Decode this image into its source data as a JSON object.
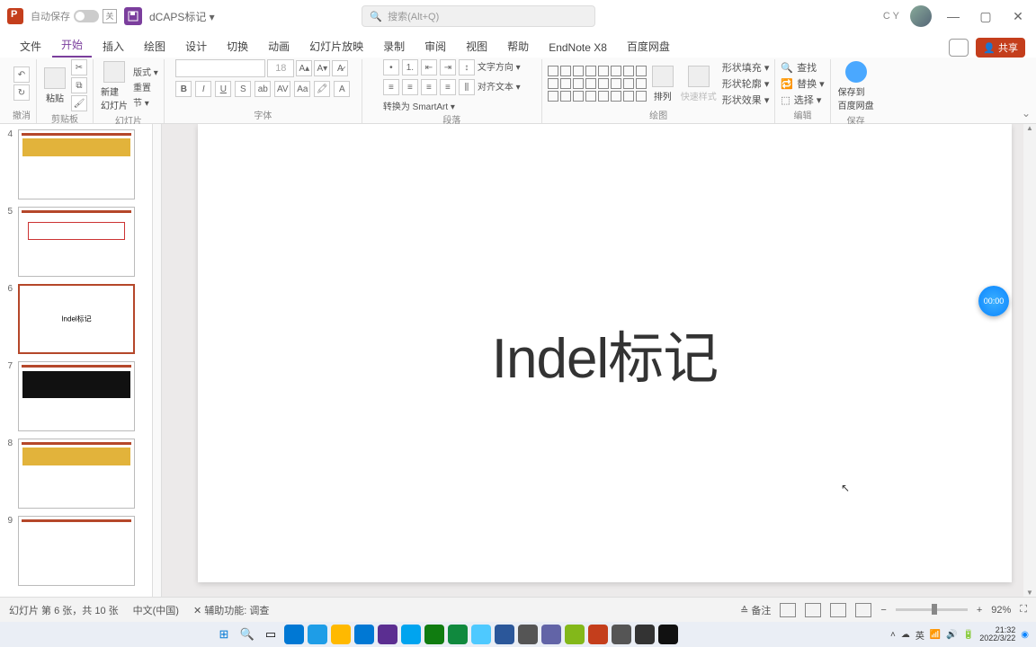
{
  "title_bar": {
    "autosave_label": "自动保存",
    "autosave_off": "关",
    "doc_name": "dCAPS标记 ▾",
    "search_placeholder": "搜索(Alt+Q)",
    "user_initials": "C Y"
  },
  "tabs": {
    "items": [
      "文件",
      "开始",
      "插入",
      "绘图",
      "设计",
      "切换",
      "动画",
      "幻灯片放映",
      "录制",
      "审阅",
      "视图",
      "帮助",
      "EndNote X8",
      "百度网盘"
    ],
    "active_index": 1,
    "share_label": "共享"
  },
  "ribbon": {
    "undo_group": "撤消",
    "clipboard_group": "剪贴板",
    "paste_label": "粘贴",
    "slides_group": "幻灯片",
    "new_slide_label": "新建\n幻灯片",
    "layout_label": "版式 ▾",
    "reset_label": "重置",
    "section_label": "节 ▾",
    "font_group": "字体",
    "font_size": "18",
    "paragraph_group": "段落",
    "text_dir": "文字方向 ▾",
    "align_text": "对齐文本 ▾",
    "smartart": "转换为 SmartArt ▾",
    "drawing_group": "绘图",
    "arrange_label": "排列",
    "quick_style": "快速样式",
    "shape_fill": "形状填充 ▾",
    "shape_outline": "形状轮廓 ▾",
    "shape_effects": "形状效果 ▾",
    "editing_group": "编辑",
    "find_label": "查找",
    "replace_label": "替换 ▾",
    "select_label": "选择 ▾",
    "save_group": "保存",
    "save_to": "保存到\n百度网盘"
  },
  "thumbs": {
    "numbers": [
      "4",
      "5",
      "6",
      "7",
      "8",
      "9"
    ],
    "selected_index": 2,
    "slide6_text": "Indel标记"
  },
  "slide": {
    "main_text": "Indel标记"
  },
  "recorder": {
    "time": "00:00"
  },
  "status": {
    "slide_info": "幻灯片 第 6 张，共 10 张",
    "language": "中文(中国)",
    "access": "辅助功能: 调查",
    "notes_label": "备注",
    "zoom": "92%"
  },
  "taskbar": {
    "time": "21:32",
    "date": "2022/3/22",
    "ime": "英"
  }
}
